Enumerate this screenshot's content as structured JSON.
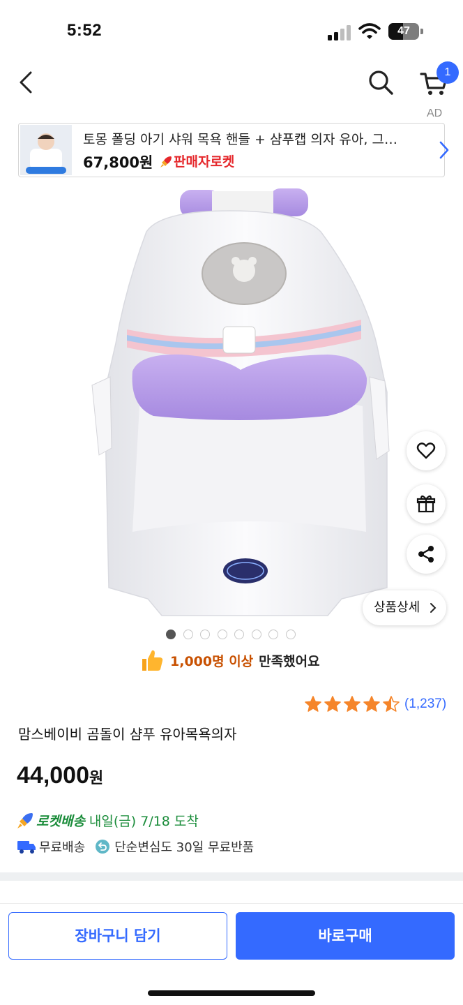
{
  "status_bar": {
    "time": "5:52",
    "battery_level": "47",
    "battery_fraction": 0.47
  },
  "header": {
    "back_icon": "chevron-left-icon",
    "search_icon": "search-icon",
    "cart_icon": "cart-icon",
    "cart_count": "1",
    "ad_label": "AD"
  },
  "ad_banner": {
    "title": "토몽 폴딩 아기 샤워 목욕 핸들 + 샴푸캡 의자 유아, 그…",
    "price": "67,800원",
    "badge": "판매자로켓",
    "arrow_icon": "chevron-right-icon"
  },
  "gallery": {
    "page_count": 8,
    "active_index": 0,
    "actions": {
      "wish_icon": "heart-icon",
      "gift_icon": "gift-icon",
      "share_icon": "share-icon",
      "detail_label": "상품상세"
    }
  },
  "satisfaction": {
    "count": "1,000명 이상",
    "text": "만족했어요"
  },
  "rating": {
    "stars": 4.5,
    "review_count": "(1,237)"
  },
  "product": {
    "name": "맘스베이비 곰돌이 샴푸 유아목욕의자",
    "price": "44,000",
    "price_unit": "원"
  },
  "delivery": {
    "rocket_label": "로켓배송",
    "arrival": "내일(금) 7/18 도착",
    "free_shipping": "무료배송",
    "free_return": "단순변심도 30일 무료반품"
  },
  "bottom_bar": {
    "cart_add_label": "장바구니 담기",
    "buy_now_label": "바로구매"
  },
  "colors": {
    "accent": "#346aff",
    "rocket_green": "#1a8c3a",
    "satisfaction_orange": "#c85000",
    "star": "#f5852a"
  }
}
